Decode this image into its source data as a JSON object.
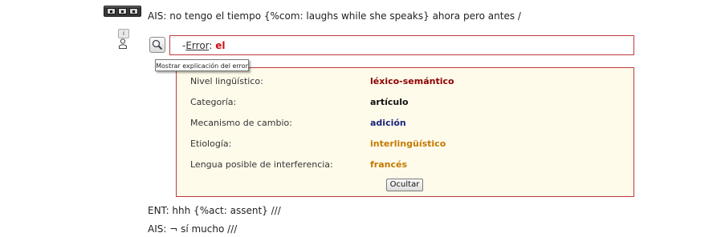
{
  "transcript": {
    "line1": "AIS: no tengo el tiempo {%com: laughs while she speaks} ahora pero antes /",
    "line2": "ENT: hhh {%act: assent} ///",
    "line3": "AIS: ¬ sí mucho ///"
  },
  "error": {
    "prefix": "-",
    "word": "Error",
    "separator": ": ",
    "token": "el"
  },
  "tooltip": "Mostrar explicación del error",
  "details": [
    {
      "label": "Nivel lingüístico:",
      "value": "léxico-semántico",
      "color": "#8b0000"
    },
    {
      "label": "Categoría:",
      "value": "artículo",
      "color": "#111111"
    },
    {
      "label": "Mecanismo de cambio:",
      "value": "adición",
      "color": "#1a237e"
    },
    {
      "label": "Etiología:",
      "value": "interlingüístico",
      "color": "#c47a00"
    },
    {
      "label": "Lengua posible de interferencia:",
      "value": "francés",
      "color": "#c47a00"
    }
  ],
  "hide_button": "Ocultar",
  "icons": {
    "player": "media-player-icon",
    "info": "info-icon",
    "person": "person-icon",
    "magnifier": "magnifier-icon"
  },
  "colors": {
    "panel_background": "#fffbeb",
    "border_red": "#c0393b",
    "error_token": "#d01010"
  }
}
